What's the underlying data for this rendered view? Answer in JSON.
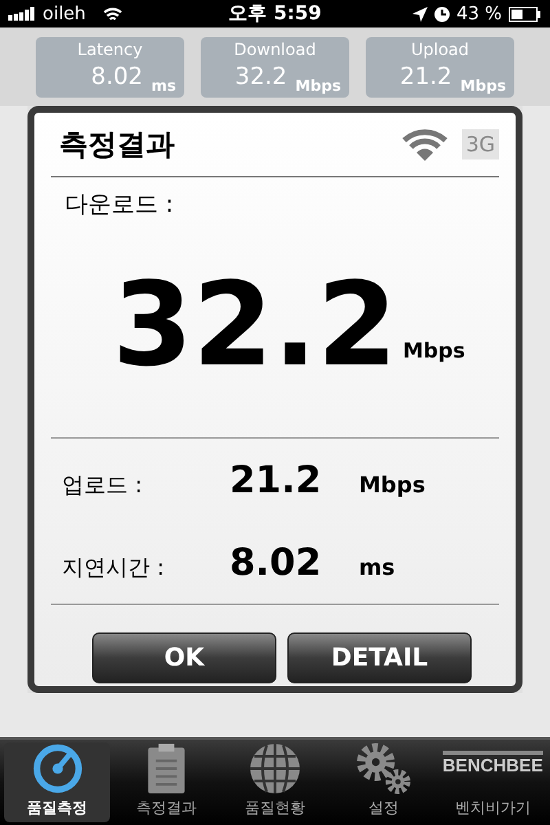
{
  "status_bar": {
    "carrier": "oileh",
    "time": "오후 5:59",
    "battery": "43 %"
  },
  "summary_tiles": [
    {
      "label": "Latency",
      "value": "8.02",
      "unit": "ms"
    },
    {
      "label": "Download",
      "value": "32.2",
      "unit": "Mbps"
    },
    {
      "label": "Upload",
      "value": "21.2",
      "unit": "Mbps"
    }
  ],
  "dialog": {
    "title": "측정결과",
    "badge": {
      "label": "3G",
      "disabled": true
    },
    "download_label": "다운로드 :",
    "download_value": "32.2",
    "download_unit": "Mbps",
    "rows": [
      {
        "label": "업로드 :",
        "value": "21.2",
        "unit": "Mbps"
      },
      {
        "label": "지연시간 :",
        "value": "8.02",
        "unit": "ms"
      }
    ],
    "buttons": [
      "OK",
      "DETAIL"
    ]
  },
  "tab_bar": {
    "items": [
      {
        "label": "품질측정",
        "selected": true
      },
      {
        "label": "측정결과",
        "selected": false
      },
      {
        "label": "품질현황",
        "selected": false
      },
      {
        "label": "설정",
        "selected": false
      },
      {
        "label": "벤치비가기",
        "selected": false,
        "logo": "BENCHBEE"
      }
    ]
  }
}
